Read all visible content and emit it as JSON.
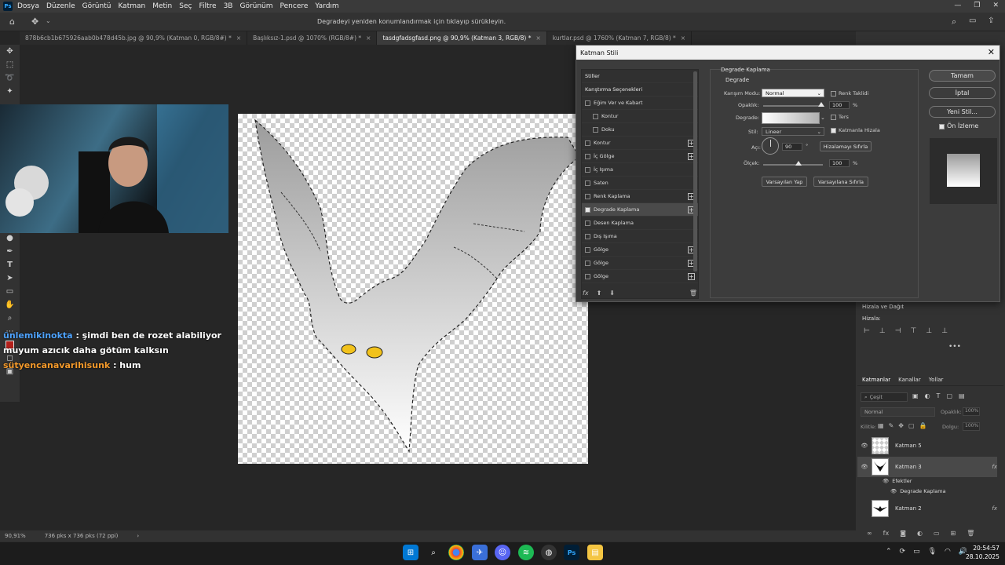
{
  "menu": [
    "Dosya",
    "Düzenle",
    "Görüntü",
    "Katman",
    "Metin",
    "Seç",
    "Filtre",
    "3B",
    "Görünüm",
    "Pencere",
    "Yardım"
  ],
  "app_logo": "Ps",
  "options_hint": "Degradeyi yeniden konumlandırmak için tıklayıp sürükleyin.",
  "tabs": [
    {
      "label": "878b6cb1b675926aab0b478d45b.jpg @ 90,9% (Katman 0, RGB/8#) *"
    },
    {
      "label": "Başlıksız-1.psd @ 1070% (RGB/8#) *"
    },
    {
      "label": "tasdgfadsgfasd.png @ 90,9% (Katman 3, RGB/8) *",
      "active": true
    },
    {
      "label": "kurtlar.psd @ 1760% (Katman 7, RGB/8) *"
    }
  ],
  "chat": [
    {
      "user": "ünlemikinokta",
      "text": ": şimdi ben de rozet alabiliyor muyum azıcık daha götüm kalksın",
      "color": "#4ea3ff"
    },
    {
      "user": "sütyencanavarihisunk",
      "text": ": hum",
      "color": "#f59a2b"
    }
  ],
  "status": {
    "zoom": "90,91%",
    "size": "736 pks x 736 pks (72 ppi)"
  },
  "dialog": {
    "title": "Katman Stili",
    "styles_header": "Stiller",
    "blend_options": "Karıştırma Seçenekleri",
    "styles": [
      {
        "label": "Eğim Ver ve Kabart",
        "checked": false,
        "plus": false
      },
      {
        "label": "Kontur",
        "checked": false,
        "plus": false,
        "indent": true
      },
      {
        "label": "Doku",
        "checked": false,
        "plus": false,
        "indent": true
      },
      {
        "label": "Kontur",
        "checked": false,
        "plus": true
      },
      {
        "label": "İç Gölge",
        "checked": false,
        "plus": true
      },
      {
        "label": "İç Işıma",
        "checked": false,
        "plus": false
      },
      {
        "label": "Saten",
        "checked": false,
        "plus": false
      },
      {
        "label": "Renk Kaplama",
        "checked": false,
        "plus": true
      },
      {
        "label": "Degrade Kaplama",
        "checked": true,
        "plus": true,
        "selected": true
      },
      {
        "label": "Desen Kaplama",
        "checked": false,
        "plus": false
      },
      {
        "label": "Dış Işıma",
        "checked": false,
        "plus": false
      },
      {
        "label": "Gölge",
        "checked": false,
        "plus": true
      },
      {
        "label": "Gölge",
        "checked": false,
        "plus": true
      },
      {
        "label": "Gölge",
        "checked": false,
        "plus": true
      }
    ],
    "fx_label": "fx",
    "section_title": "Degrade Kaplama",
    "subsection": "Degrade",
    "blend_mode_label": "Karışım Modu:",
    "blend_mode_value": "Normal",
    "dither_label": "Renk Taklidi",
    "opacity_label": "Opaklık:",
    "opacity_value": "100",
    "percent": "%",
    "gradient_label": "Degrade:",
    "reverse_label": "Ters",
    "style_label": "Stil:",
    "style_value": "Lineer",
    "align_label": "Katmanla Hizala",
    "angle_label": "Açı:",
    "angle_value": "90",
    "degree": "°",
    "reset_align": "Hizalamayı Sıfırla",
    "scale_label": "Ölçek:",
    "scale_value": "100",
    "make_default": "Varsayılan Yap",
    "reset_default": "Varsayılana Sıfırla",
    "ok": "Tamam",
    "cancel": "İptal",
    "new_style": "Yeni Stil...",
    "preview_label": "Ön İzleme",
    "preview_checked": true
  },
  "panels": {
    "align_title": "Hizala ve Dağıt",
    "align_label": "Hizala:",
    "layers_tabs": [
      "Katmanlar",
      "Kanallar",
      "Yollar"
    ],
    "filter_placeholder": "Çeşit",
    "blend_mode": "Normal",
    "opacity_label": "Opaklık:",
    "opacity_value": "100%",
    "lock_label": "Kilitle:",
    "fill_label": "Dolgu:",
    "fill_value": "100%",
    "layers": [
      {
        "name": "Katman 5",
        "fx": false
      },
      {
        "name": "Katman 3",
        "fx": true,
        "selected": true
      },
      {
        "name": "Katman 2",
        "fx": true
      }
    ],
    "effects_label": "Efektler",
    "effect_item": "Degrade Kaplama"
  },
  "taskbar": {
    "time": "20:54:57",
    "date": "28.10.2025"
  }
}
